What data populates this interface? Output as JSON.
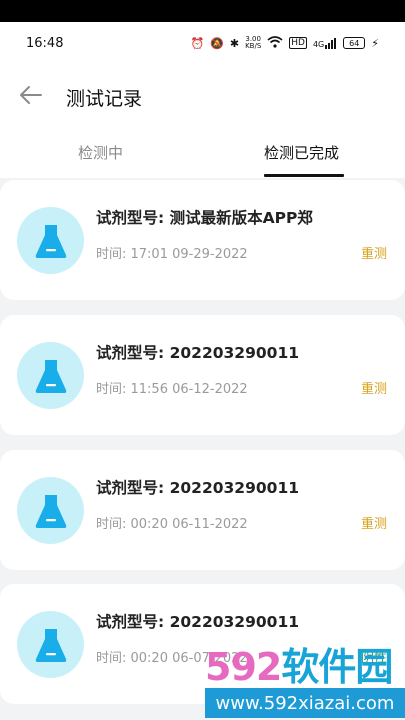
{
  "status": {
    "time": "16:48",
    "net_speed_top": "3.00",
    "net_speed_unit": "KB/S",
    "hd": "HD",
    "signal": "4G",
    "battery": "64"
  },
  "header": {
    "title": "测试记录"
  },
  "tabs": [
    {
      "label": "检测中",
      "active": false
    },
    {
      "label": "检测已完成",
      "active": true
    }
  ],
  "records": [
    {
      "title": "试剂型号: 测试最新版本APP郑",
      "time": "时间: 17:01 09-29-2022",
      "action": "重测"
    },
    {
      "title": "试剂型号: 202203290011",
      "time": "时间: 11:56 06-12-2022",
      "action": "重测"
    },
    {
      "title": "试剂型号: 202203290011",
      "time": "时间: 00:20 06-11-2022",
      "action": "重测"
    },
    {
      "title": "试剂型号: 202203290011",
      "time": "时间: 00:20 06-07-2022",
      "action": "阴性"
    }
  ],
  "watermark": {
    "number": "592",
    "brand": "软件园",
    "url": "www.592xiazai.com"
  },
  "colors": {
    "accent_action": "#d8a21e",
    "flask": "#19aeea",
    "avatar_bg": "#c8f0f8"
  }
}
